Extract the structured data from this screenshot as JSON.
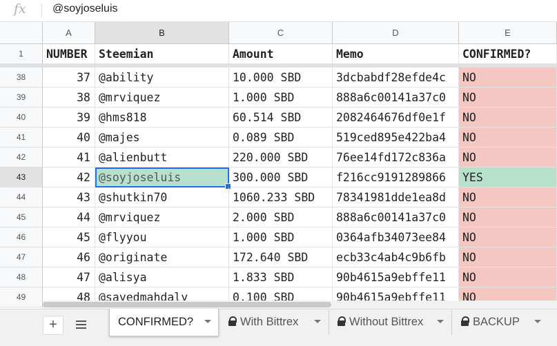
{
  "formula_bar": {
    "icon": "fx",
    "value": "@soyjoseluis"
  },
  "columns": [
    "A",
    "B",
    "C",
    "D",
    "E"
  ],
  "header_row": {
    "row_number": "1",
    "cells": [
      "NUMBER",
      "Steemian",
      "Amount",
      "Memo",
      "CONFIRMED?"
    ]
  },
  "rows": [
    {
      "row_number": "38",
      "number": "37",
      "steemian": "@ability",
      "amount": "10.000 SBD",
      "memo": "3dcbabdf28efde4c",
      "confirmed": "NO"
    },
    {
      "row_number": "39",
      "number": "38",
      "steemian": "@mrviquez",
      "amount": "1.000 SBD",
      "memo": "888a6c00141a37c0",
      "confirmed": "NO"
    },
    {
      "row_number": "40",
      "number": "39",
      "steemian": "@hms818",
      "amount": "60.514 SBD",
      "memo": "2082464676df0e1f",
      "confirmed": "NO"
    },
    {
      "row_number": "41",
      "number": "40",
      "steemian": "@majes",
      "amount": "0.089 SBD",
      "memo": "519ced895e422ba4",
      "confirmed": "NO"
    },
    {
      "row_number": "42",
      "number": "41",
      "steemian": "@alienbutt",
      "amount": "220.000 SBD",
      "memo": "76ee14fd172c836a",
      "confirmed": "NO"
    },
    {
      "row_number": "43",
      "number": "42",
      "steemian": "@soyjoseluis",
      "amount": "300.000 SBD",
      "memo": "f216cc9191289866",
      "confirmed": "YES"
    },
    {
      "row_number": "44",
      "number": "43",
      "steemian": "@shutkin70",
      "amount": "1060.233 SBD",
      "memo": "78341981dde1ea8d",
      "confirmed": "NO"
    },
    {
      "row_number": "45",
      "number": "44",
      "steemian": "@mrviquez",
      "amount": "2.000 SBD",
      "memo": "888a6c00141a37c0",
      "confirmed": "NO"
    },
    {
      "row_number": "46",
      "number": "45",
      "steemian": "@flyyou",
      "amount": "1.000 SBD",
      "memo": "0364afb34073ee84",
      "confirmed": "NO"
    },
    {
      "row_number": "47",
      "number": "46",
      "steemian": "@originate",
      "amount": "172.640 SBD",
      "memo": "ecb33c4ab4c9b6fb",
      "confirmed": "NO"
    },
    {
      "row_number": "48",
      "number": "47",
      "steemian": "@alisya",
      "amount": "1.833 SBD",
      "memo": "90b4615a9ebffe11",
      "confirmed": "NO"
    },
    {
      "row_number": "49",
      "number": "48",
      "steemian": "@sayedmahdaly",
      "amount": "0.100 SBD",
      "memo": "90b4615a9ebffe11",
      "confirmed": "NO"
    }
  ],
  "colors": {
    "no_fill": "#f4c7c3",
    "yes_fill": "#b7e1cd",
    "selection": "#1a73e8"
  },
  "sheet_tabs": [
    {
      "label": "CONFIRMED?",
      "locked": false,
      "active": true
    },
    {
      "label": "With Bittrex",
      "locked": true,
      "active": false
    },
    {
      "label": "Without Bittrex",
      "locked": true,
      "active": false
    },
    {
      "label": "BACKUP",
      "locked": true,
      "active": false
    }
  ]
}
